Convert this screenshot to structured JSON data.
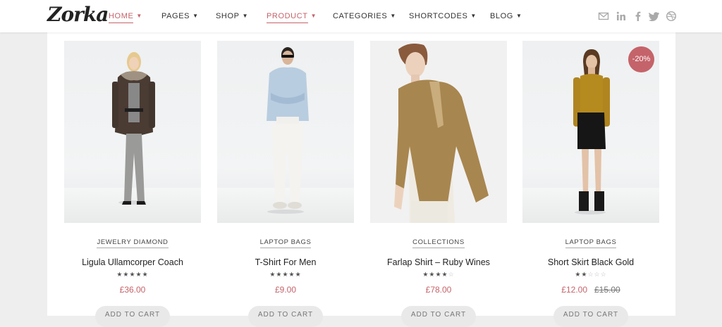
{
  "logo": "Zorka",
  "nav": [
    {
      "label": "HOME",
      "active": true
    },
    {
      "label": "PAGES",
      "active": false
    },
    {
      "label": "SHOP",
      "active": false
    },
    {
      "label": "PRODUCT",
      "active": true
    },
    {
      "label": "CATEGORIES",
      "active": false
    },
    {
      "label": "SHORTCODES",
      "active": false
    },
    {
      "label": "BLOG",
      "active": false
    }
  ],
  "social_icons": [
    "envelope-icon",
    "linkedin-icon",
    "facebook-icon",
    "twitter-icon",
    "dribbble-icon"
  ],
  "colors": {
    "accent": "#c5636a",
    "text": "#222222",
    "muted": "#aaaaaa"
  },
  "products": [
    {
      "category": "JEWELRY DIAMOND",
      "title": "Ligula Ullamcorper Coach",
      "rating": 5,
      "price": "£36.00",
      "old_price": "",
      "badge": "",
      "cart_label": "ADD TO CART"
    },
    {
      "category": "LAPTOP BAGS",
      "title": "T-Shirt For Men",
      "rating": 5,
      "price": "£9.00",
      "old_price": "",
      "badge": "",
      "cart_label": "ADD TO CART"
    },
    {
      "category": "COLLECTIONS",
      "title": "Farlap Shirt – Ruby Wines",
      "rating": 4,
      "price": "£78.00",
      "old_price": "",
      "badge": "",
      "cart_label": "ADD TO CART"
    },
    {
      "category": "LAPTOP BAGS",
      "title": "Short Skirt Black Gold",
      "rating": 2,
      "price": "£12.00",
      "old_price": "£15.00",
      "badge": "-20%",
      "cart_label": "ADD TO CART"
    }
  ]
}
